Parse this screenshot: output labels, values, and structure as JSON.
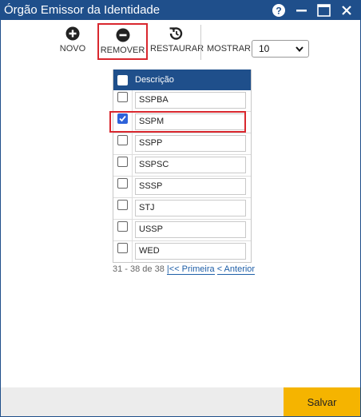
{
  "window": {
    "title": "Órgão Emissor da Identidade"
  },
  "toolbar": {
    "novo_label": "NOVO",
    "remover_label": "REMOVER",
    "restaurar_label": "RESTAURAR",
    "mostrar_label": "MOSTRAR:",
    "mostrar_value": "10"
  },
  "grid": {
    "header": "Descrição",
    "rows": [
      {
        "label": "SSPBA",
        "checked": false
      },
      {
        "label": "SSPM",
        "checked": true
      },
      {
        "label": "SSPP",
        "checked": false
      },
      {
        "label": "SSPSC",
        "checked": false
      },
      {
        "label": "SSSP",
        "checked": false
      },
      {
        "label": "STJ",
        "checked": false
      },
      {
        "label": "USSP",
        "checked": false
      },
      {
        "label": "WED",
        "checked": false
      }
    ]
  },
  "pager": {
    "range": "31 - 38 de 38",
    "first": "|<< Primeira",
    "prev": "< Anterior"
  },
  "footer": {
    "save_label": "Salvar"
  },
  "colors": {
    "titlebar": "#1f4f8b",
    "accent": "#f5b400",
    "highlight": "#d9272e",
    "checkbox": "#2e62d9"
  },
  "icons": [
    "help-icon",
    "minimize-icon",
    "maximize-icon",
    "close-icon",
    "plus-circle-icon",
    "minus-circle-icon",
    "restore-icon",
    "chevron-down-icon",
    "checkmark-icon"
  ]
}
